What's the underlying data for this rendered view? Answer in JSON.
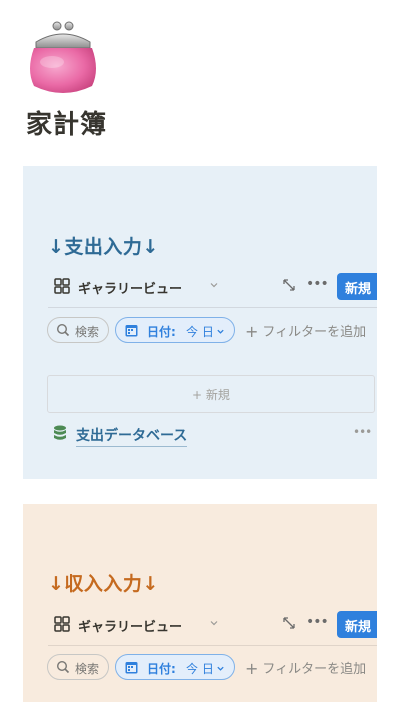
{
  "page": {
    "icon": "coin-purse-icon",
    "title": "家計簿"
  },
  "expense": {
    "heading": "↓支出入力↓",
    "heading_color": "#2e6a95",
    "view_name": "ギャラリービュー",
    "new_label": "新規",
    "search_label": "検索",
    "date_filter_key": "日付:",
    "date_filter_value": "今 日",
    "add_filter_label": "フィルターを追加",
    "new_card_label": "新規",
    "database_link": "支出データベース"
  },
  "income": {
    "heading": "↓収入入力↓",
    "heading_color": "#c56a1f",
    "view_name": "ギャラリービュー",
    "new_label": "新規",
    "search_label": "検索",
    "date_filter_key": "日付:",
    "date_filter_value": "今 日",
    "add_filter_label": "フィルターを追加"
  },
  "colors": {
    "accent": "#2f80dd",
    "expense_bg": "#e7f0f7",
    "income_bg": "#f8ebde"
  }
}
